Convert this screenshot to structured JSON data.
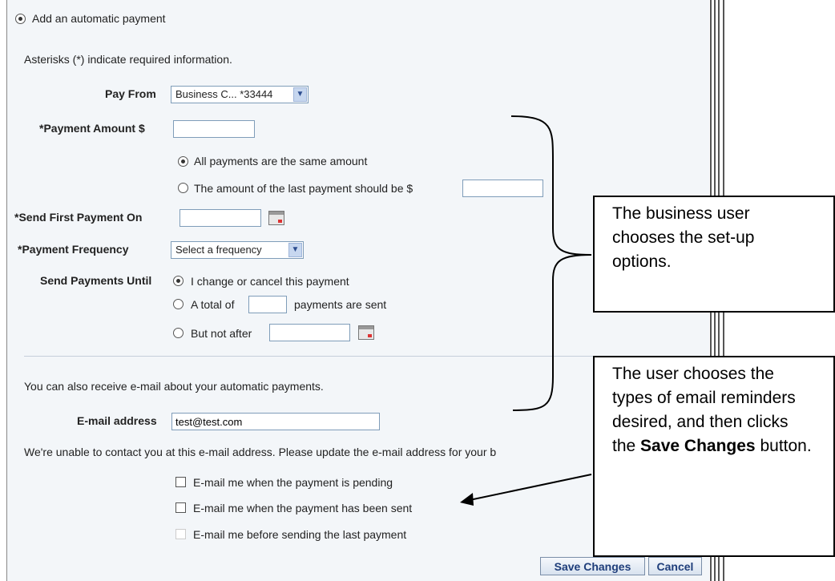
{
  "header": {
    "title": "Add an automatic payment"
  },
  "form": {
    "required_note": "Asterisks (*) indicate required information.",
    "pay_from_label": "Pay From",
    "pay_from_value": "Business C... *33444",
    "amount_label": "*Payment Amount $",
    "amount_value": "",
    "same_amount_label": "All payments are the same amount",
    "last_amount_label": "The amount of the last payment should be $",
    "last_amount_value": "",
    "first_payment_label": "*Send First Payment On",
    "first_payment_value": "",
    "frequency_label": "*Payment Frequency",
    "frequency_value": "Select a frequency",
    "until_label": "Send Payments Until",
    "until_change_label": "I change or cancel this payment",
    "until_total_prefix": "A total of",
    "until_total_value": "",
    "until_total_suffix": "payments are sent",
    "until_after_label": "But not after",
    "until_after_value": ""
  },
  "email": {
    "intro": "You can also receive e-mail about your automatic payments.",
    "address_label": "E-mail address",
    "address_value": "test@test.com",
    "warning": "We're unable to contact you at this e-mail address. Please update the e-mail address for your b",
    "opt_pending": "E-mail me when the payment is pending",
    "opt_sent": "E-mail me when the payment has been sent",
    "opt_last": "E-mail me before sending the last payment"
  },
  "buttons": {
    "save": "Save Changes",
    "cancel": "Cancel"
  },
  "callouts": {
    "setup_text": "The business user chooses the set-up options.",
    "email_line1": "The user chooses the types of email reminders desired, and then clicks the",
    "email_bold": "Save Changes",
    "email_line2": "button."
  }
}
